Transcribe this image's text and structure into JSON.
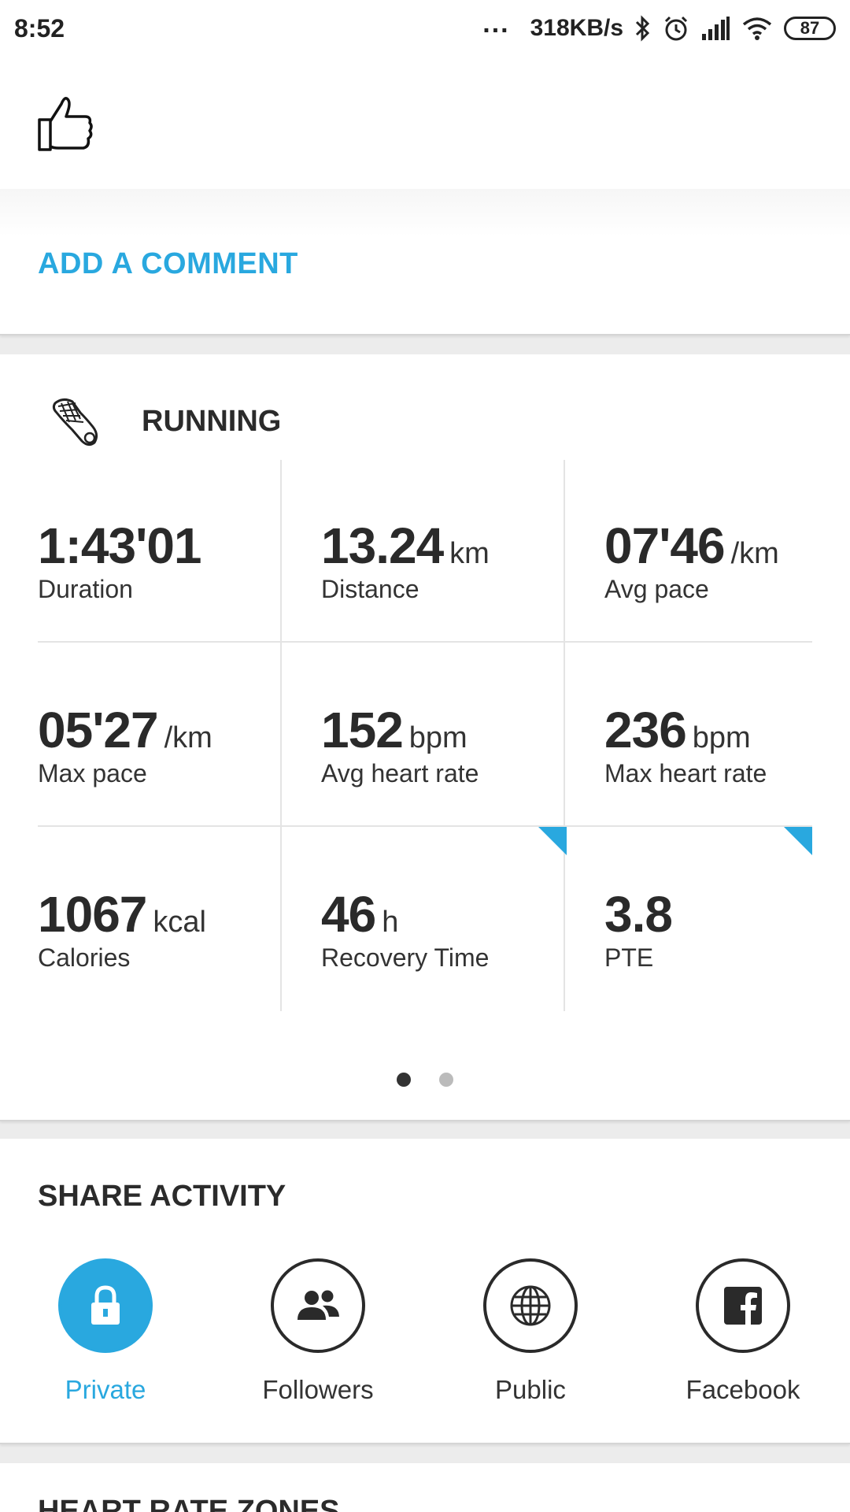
{
  "status_bar": {
    "time": "8:52",
    "dots": "...",
    "speed": "318KB/s",
    "battery": "87",
    "icons": [
      "bluetooth-icon",
      "alarm-icon",
      "signal-icon",
      "wifi-icon",
      "battery-icon"
    ]
  },
  "like": {
    "icon": "thumbs-up-icon"
  },
  "comment": {
    "add_label": "ADD A COMMENT"
  },
  "activity": {
    "sport_icon": "running-shoe-icon",
    "sport": "RUNNING",
    "stats": [
      {
        "value": "1:43'01",
        "unit": "",
        "label": "Duration",
        "corner": false
      },
      {
        "value": "13.24",
        "unit": "km",
        "label": "Distance",
        "corner": false
      },
      {
        "value": "07'46",
        "unit": "/km",
        "label": "Avg pace",
        "corner": false
      },
      {
        "value": "05'27",
        "unit": "/km",
        "label": "Max pace",
        "corner": false
      },
      {
        "value": "152",
        "unit": "bpm",
        "label": "Avg heart rate",
        "corner": false
      },
      {
        "value": "236",
        "unit": "bpm",
        "label": "Max heart rate",
        "corner": false
      },
      {
        "value": "1067",
        "unit": "kcal",
        "label": "Calories",
        "corner": false
      },
      {
        "value": "46",
        "unit": "h",
        "label": "Recovery Time",
        "corner": true
      },
      {
        "value": "3.8",
        "unit": "",
        "label": "PTE",
        "corner": true
      }
    ],
    "page_count": 2,
    "current_page": 1
  },
  "share": {
    "title": "SHARE ACTIVITY",
    "options": [
      {
        "label": "Private",
        "icon": "lock-icon",
        "selected": true
      },
      {
        "label": "Followers",
        "icon": "followers-icon",
        "selected": false
      },
      {
        "label": "Public",
        "icon": "globe-icon",
        "selected": false
      },
      {
        "label": "Facebook",
        "icon": "facebook-icon",
        "selected": false
      }
    ]
  },
  "next_section": {
    "title": "HEART RATE ZONES"
  },
  "colors": {
    "accent": "#29a8df",
    "text": "#2a2a2a",
    "divider": "#e4e4e4"
  }
}
